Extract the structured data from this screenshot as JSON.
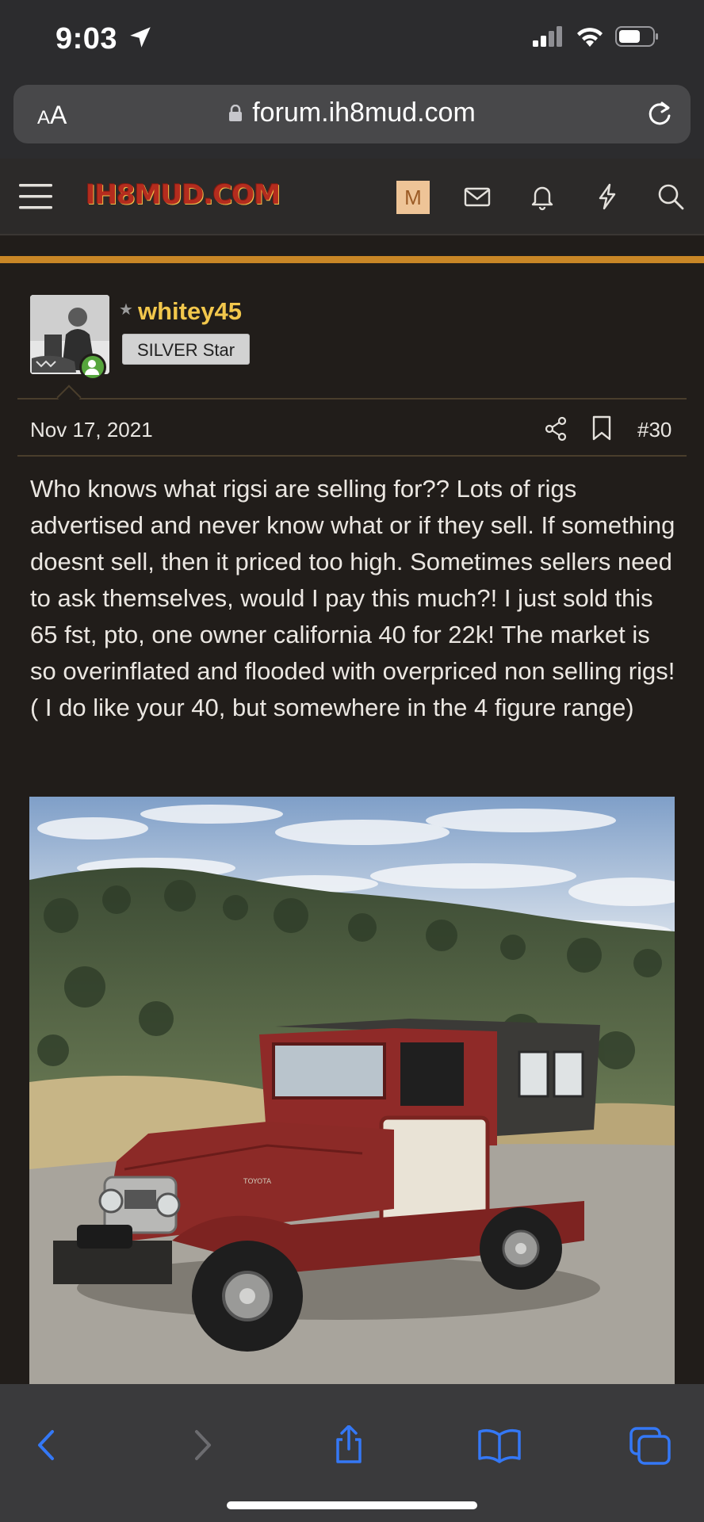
{
  "status_bar": {
    "time": "9:03",
    "icons": [
      "location-arrow-icon",
      "cellular-signal-icon",
      "wifi-icon",
      "battery-icon"
    ]
  },
  "browser": {
    "text_size_label_small": "A",
    "text_size_label_large": "A",
    "url": "forum.ih8mud.com",
    "icons": [
      "lock-icon",
      "reload-icon"
    ]
  },
  "site_header": {
    "logo_text": "IH8MUD.COM",
    "user_initial": "M",
    "icons": [
      "hamburger-menu-icon",
      "envelope-icon",
      "bell-icon",
      "lightning-icon",
      "search-icon"
    ]
  },
  "post": {
    "username": "whitey45",
    "user_title": "SILVER Star",
    "date": "Nov 17, 2021",
    "post_number": "#30",
    "body": "Who knows what rigsi are selling for?? Lots of rigs advertised and never know what or if they sell. If something doesnt sell, then it priced too high. Sometimes sellers need to ask themselves, would I pay this much?! I just sold this 65 fst, pto, one owner california 40 for 22k! The market is so overinflated and flooded with overpriced non selling rigs!( I do like your 40, but somewhere in the 4 figure range)",
    "photo_badge": "TOYOTA"
  },
  "bottom_toolbar": {
    "icons": [
      "back-icon",
      "forward-icon",
      "share-icon",
      "bookmarks-icon",
      "tabs-icon"
    ]
  },
  "colors": {
    "accent": "#c88626",
    "username": "#f2c74c",
    "background": "#211d1a",
    "toolbar_icon": "#3478f6"
  }
}
